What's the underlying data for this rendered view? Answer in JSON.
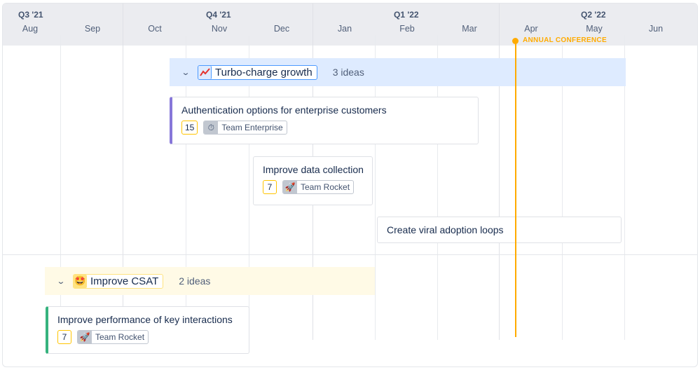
{
  "timeline": {
    "quarters": [
      "Q3 '21",
      "Q4 '21",
      "Q1 '22",
      "Q2 '22"
    ],
    "months": [
      "Aug",
      "Sep",
      "Oct",
      "Nov",
      "Dec",
      "Jan",
      "Feb",
      "Mar",
      "Apr",
      "May",
      "Jun"
    ],
    "marker": {
      "label": "ANNUAL CONFERENCE",
      "color": "#ffab00"
    }
  },
  "groups": [
    {
      "title": "Turbo-charge growth",
      "icon": "chart-increasing-icon",
      "count": "3 ideas",
      "color": "#deebff",
      "ideas": [
        {
          "title": "Authentication options for enterprise customers",
          "score": "15",
          "team": "Team Enterprise",
          "team_icon": "stopwatch-icon",
          "accent": "#8777d9"
        },
        {
          "title": "Improve data collection",
          "score": "7",
          "team": "Team Rocket",
          "team_icon": "rocket-icon"
        },
        {
          "title": "Create viral adoption loops"
        }
      ]
    },
    {
      "title": "Improve CSAT",
      "icon": "star-struck-face-icon",
      "count": "2 ideas",
      "color": "#fffae6",
      "ideas": [
        {
          "title": "Improve performance of key interactions",
          "score": "7",
          "team": "Team Rocket",
          "team_icon": "rocket-icon",
          "accent": "#36b37e"
        }
      ]
    }
  ]
}
